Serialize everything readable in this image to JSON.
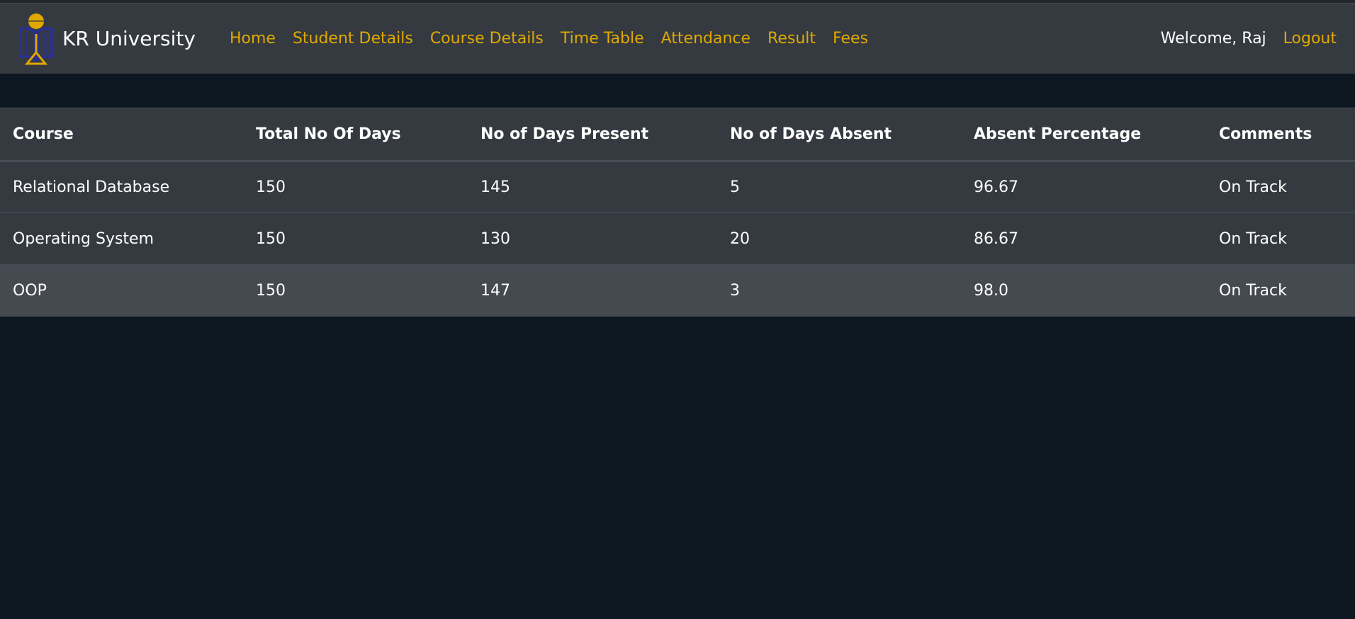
{
  "brand": {
    "name": "KR University",
    "colors": {
      "navbar_bg": "#343a40",
      "accent": "#e0a800",
      "page_bg": "#0d1823",
      "logo_blue": "#2a2f8f",
      "logo_gold": "#e0a800"
    }
  },
  "nav": {
    "links": [
      "Home",
      "Student Details",
      "Course Details",
      "Time Table",
      "Attendance",
      "Result",
      "Fees"
    ],
    "welcome": "Welcome, Raj",
    "logout": "Logout"
  },
  "table": {
    "headers": [
      "Course",
      "Total No Of Days",
      "No of Days Present",
      "No of Days Absent",
      "Absent Percentage",
      "Comments"
    ],
    "rows": [
      [
        "Relational Database",
        "150",
        "145",
        "5",
        "96.67",
        "On Track"
      ],
      [
        "Operating System",
        "150",
        "130",
        "20",
        "86.67",
        "On Track"
      ],
      [
        "OOP",
        "150",
        "147",
        "3",
        "98.0",
        "On Track"
      ]
    ]
  }
}
